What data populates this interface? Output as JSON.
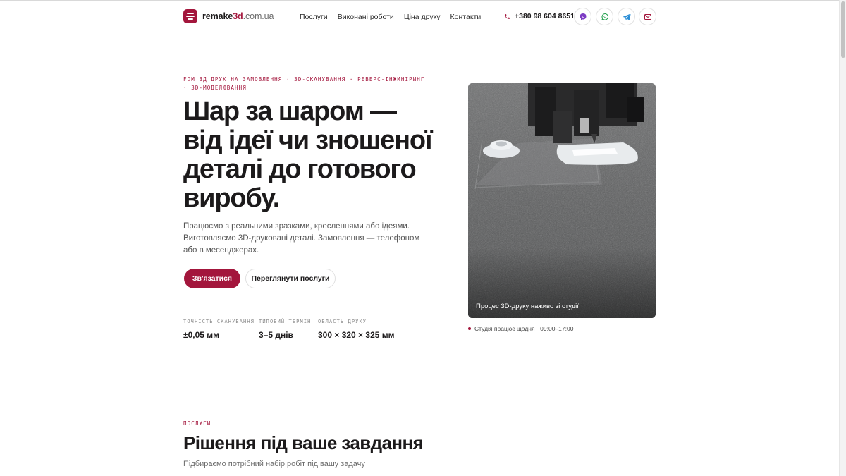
{
  "header": {
    "logo_brand": "remake",
    "logo_3d": "3d",
    "logo_domain": ".com.ua",
    "nav": [
      "Послуги",
      "Виконані роботи",
      "Ціна друку",
      "Контакти"
    ],
    "phone": "+380 98 604 8651",
    "social_icons": [
      "viber-icon",
      "whatsapp-icon",
      "telegram-icon",
      "mail-icon"
    ]
  },
  "hero": {
    "eyebrow": "FDM 3Д друк на замовлення · 3D-сканування · реверс-інжиніринг · 3D-моделювання",
    "title": "Шар за шаром — від ідеї чи зношеної деталі до готового виробу.",
    "description": "Працюємо з реальними зразками, кресленнями або ідеями. Виготовляємо 3D-друковані деталі. Замовлення — телефоном або в месенджерах.",
    "primary_button": "Зв'язатися",
    "secondary_button": "Переглянути послуги",
    "stats": [
      {
        "label": "Точність сканування",
        "value": "±0,05 мм"
      },
      {
        "label": "Типовий термін",
        "value": "3–5 днів"
      },
      {
        "label": "Область друку",
        "value": "300 × 320 × 325 мм"
      }
    ],
    "video_caption": "Процес 3D-друку наживо зі студії",
    "studio_status": "Студія працює щодня · 09:00–17:00"
  },
  "services": {
    "eyebrow": "Послуги",
    "title": "Рішення під ваше завдання",
    "subtitle": "Підбираємо потрібний набір робіт під вашу задачу"
  },
  "colors": {
    "accent": "#a3163c",
    "text": "#1c1a1b",
    "muted": "#6a6a6a"
  }
}
